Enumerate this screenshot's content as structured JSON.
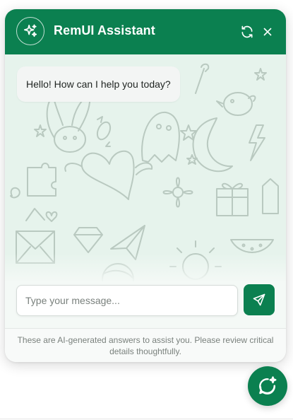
{
  "header": {
    "title": "RemUI Assistant",
    "avatar_icon": "sparkles-icon",
    "refresh_icon": "refresh-icon",
    "close_icon": "close-icon"
  },
  "messages": [
    {
      "sender": "assistant",
      "text": "Hello! How can I help you today?"
    }
  ],
  "composer": {
    "value": "",
    "placeholder": "Type your message...",
    "send_icon": "send-icon"
  },
  "footer": {
    "disclaimer": "These are AI-generated answers to assist you. Please review critical details thoughtfully."
  },
  "launcher": {
    "icon": "chat-sparkle-icon"
  },
  "colors": {
    "brand": "#0b8050",
    "chat_background": "#e6f3ec",
    "bubble": "#f3f5f4",
    "doodle_stroke": "#b9c9c0"
  }
}
